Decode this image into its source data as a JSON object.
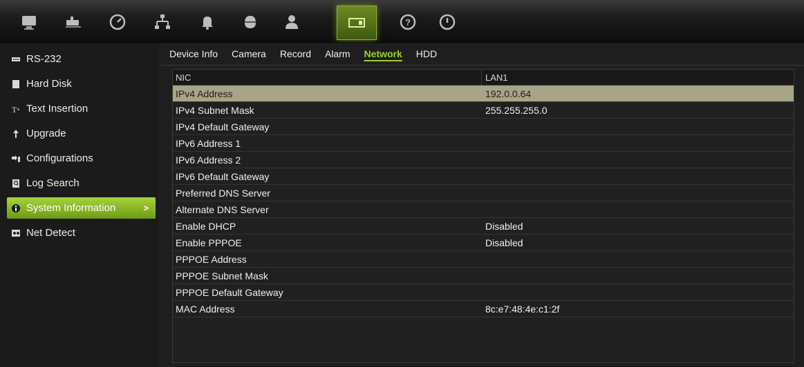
{
  "toolbar": {
    "icons": [
      {
        "name": "display-icon"
      },
      {
        "name": "camera-icon"
      },
      {
        "name": "dial-icon"
      },
      {
        "name": "network-icon"
      },
      {
        "name": "bell-icon"
      },
      {
        "name": "dome-camera-icon"
      },
      {
        "name": "user-icon"
      },
      {
        "name": "device-icon"
      },
      {
        "name": "help-icon"
      },
      {
        "name": "power-icon"
      }
    ],
    "active": "device-icon"
  },
  "sidebar": {
    "items": [
      {
        "label": "RS-232"
      },
      {
        "label": "Hard Disk"
      },
      {
        "label": "Text Insertion"
      },
      {
        "label": "Upgrade"
      },
      {
        "label": "Configurations"
      },
      {
        "label": "Log Search"
      },
      {
        "label": "System Information",
        "chevron": ">"
      },
      {
        "label": "Net Detect"
      }
    ],
    "active_index": 6
  },
  "tabs": [
    {
      "label": "Device Info"
    },
    {
      "label": "Camera"
    },
    {
      "label": "Record"
    },
    {
      "label": "Alarm"
    },
    {
      "label": "Network"
    },
    {
      "label": "HDD"
    }
  ],
  "active_tab": "Network",
  "table": {
    "headers": [
      "NIC",
      "LAN1"
    ],
    "rows": [
      {
        "field": "IPv4 Address",
        "value": "192.0.0.64"
      },
      {
        "field": "IPv4 Subnet Mask",
        "value": "255.255.255.0"
      },
      {
        "field": "IPv4 Default Gateway",
        "value": ""
      },
      {
        "field": "IPv6 Address 1",
        "value": ""
      },
      {
        "field": "IPv6 Address 2",
        "value": ""
      },
      {
        "field": "IPv6 Default Gateway",
        "value": ""
      },
      {
        "field": "Preferred DNS Server",
        "value": ""
      },
      {
        "field": "Alternate DNS Server",
        "value": ""
      },
      {
        "field": "Enable DHCP",
        "value": "Disabled"
      },
      {
        "field": "Enable PPPOE",
        "value": "Disabled"
      },
      {
        "field": "PPPOE Address",
        "value": ""
      },
      {
        "field": "PPPOE Subnet Mask",
        "value": ""
      },
      {
        "field": "PPPOE Default Gateway",
        "value": ""
      },
      {
        "field": "MAC Address",
        "value": "8c:e7:48:4e:c1:2f"
      }
    ],
    "selected_index": 0
  },
  "colors": {
    "accent_green": "#9ed12e",
    "selected_row": "#a7a488"
  }
}
